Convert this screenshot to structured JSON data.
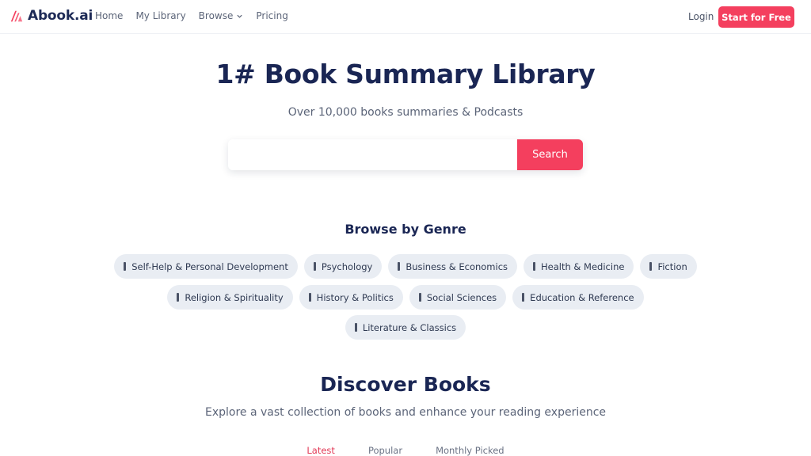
{
  "brand": {
    "name": "Abook.ai",
    "logo_icon": "abook-logo-icon",
    "accent": "#f43f5e",
    "navy": "#1a2654"
  },
  "nav": {
    "items": [
      {
        "label": "Home"
      },
      {
        "label": "My Library"
      },
      {
        "label": "Browse",
        "icon": "chevron-down-icon"
      },
      {
        "label": "Pricing"
      }
    ],
    "login_label": "Login",
    "cta_label": "Start for Free"
  },
  "hero": {
    "title": "1# Book Summary Library",
    "subtitle": "Over 10,000 books summaries & Podcasts",
    "search": {
      "value": "",
      "placeholder": "",
      "button_label": "Search"
    }
  },
  "genres": {
    "title": "Browse by Genre",
    "rows": [
      [
        {
          "label": "Self-Help & Personal Development"
        },
        {
          "label": "Psychology"
        },
        {
          "label": "Business & Economics"
        },
        {
          "label": "Health & Medicine"
        },
        {
          "label": "Fiction"
        }
      ],
      [
        {
          "label": "Religion & Spirituality"
        },
        {
          "label": "History & Politics"
        },
        {
          "label": "Social Sciences"
        },
        {
          "label": "Education & Reference"
        }
      ],
      [
        {
          "label": "Literature & Classics"
        }
      ]
    ]
  },
  "discover": {
    "title": "Discover Books",
    "subtitle": "Explore a vast collection of books and enhance your reading experience",
    "tabs": [
      {
        "label": "Latest",
        "active": true
      },
      {
        "label": "Popular",
        "active": false
      },
      {
        "label": "Monthly Picked",
        "active": false
      }
    ]
  }
}
